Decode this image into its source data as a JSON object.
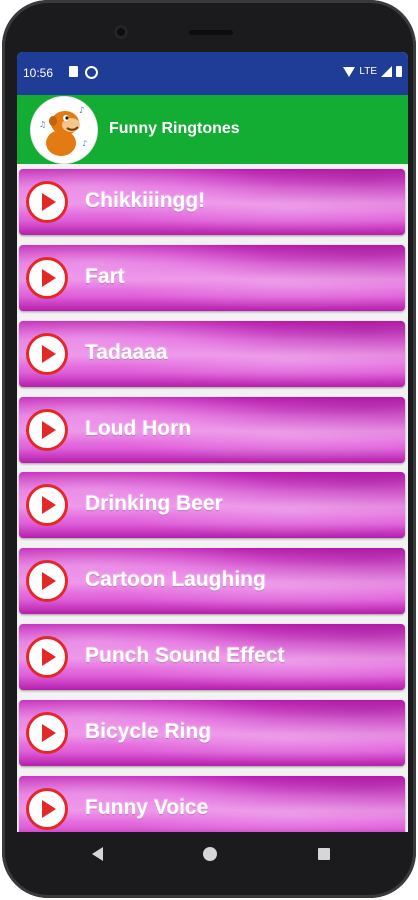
{
  "status_bar": {
    "time": "10:56",
    "network": "LTE"
  },
  "app": {
    "title": "Funny Ringtones",
    "logo_icon": "cartoon-monkey-logo"
  },
  "colors": {
    "status_bar": "#1f3c97",
    "toolbar": "#14ad34",
    "tile": "#e46ae0",
    "play": "#e32828"
  },
  "ringtones": [
    {
      "label": "Chikkiiingg!"
    },
    {
      "label": "Fart"
    },
    {
      "label": "Tadaaaa"
    },
    {
      "label": "Loud Horn"
    },
    {
      "label": "Drinking Beer"
    },
    {
      "label": "Cartoon Laughing"
    },
    {
      "label": "Punch Sound Effect"
    },
    {
      "label": "Bicycle Ring"
    },
    {
      "label": "Funny Voice"
    }
  ],
  "nav_icons": [
    "back-icon",
    "home-icon",
    "recents-icon"
  ]
}
